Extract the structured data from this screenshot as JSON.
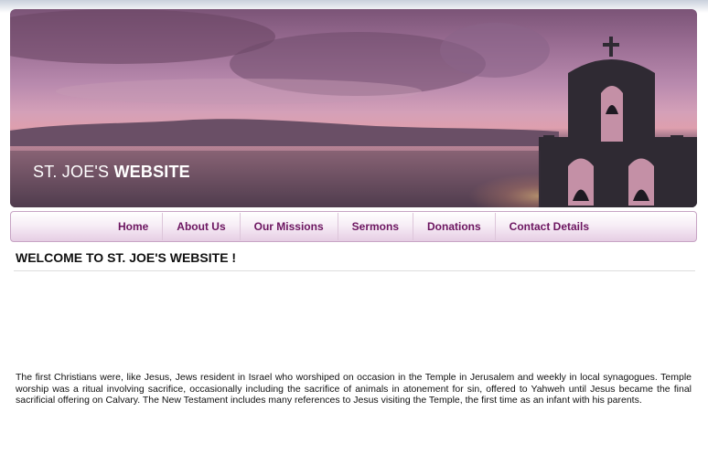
{
  "header": {
    "title_regular": "ST. JOE'S ",
    "title_bold": "WEBSITE"
  },
  "nav": {
    "items": [
      {
        "label": "Home"
      },
      {
        "label": "About Us"
      },
      {
        "label": "Our Missions"
      },
      {
        "label": "Sermons"
      },
      {
        "label": "Donations"
      },
      {
        "label": "Contact Details"
      }
    ]
  },
  "main": {
    "heading": "WELCOME TO ST. JOE'S WEBSITE !",
    "paragraph": "The first Christians were, like Jesus, Jews resident in Israel who worshiped on occasion in the Temple in Jerusalem and weekly in local synagogues. Temple worship was a ritual involving sacrifice, occasionally including the sacrifice of animals in atonement for sin, offered to Yahweh until Jesus became the final sacrificial offering on Calvary. The New Testament includes many references to Jesus visiting the Temple, the first time as an infant with his parents."
  },
  "colors": {
    "nav_text": "#6c1560",
    "nav_border": "#c7a4c4",
    "banner_sky": "#9a6d93"
  }
}
